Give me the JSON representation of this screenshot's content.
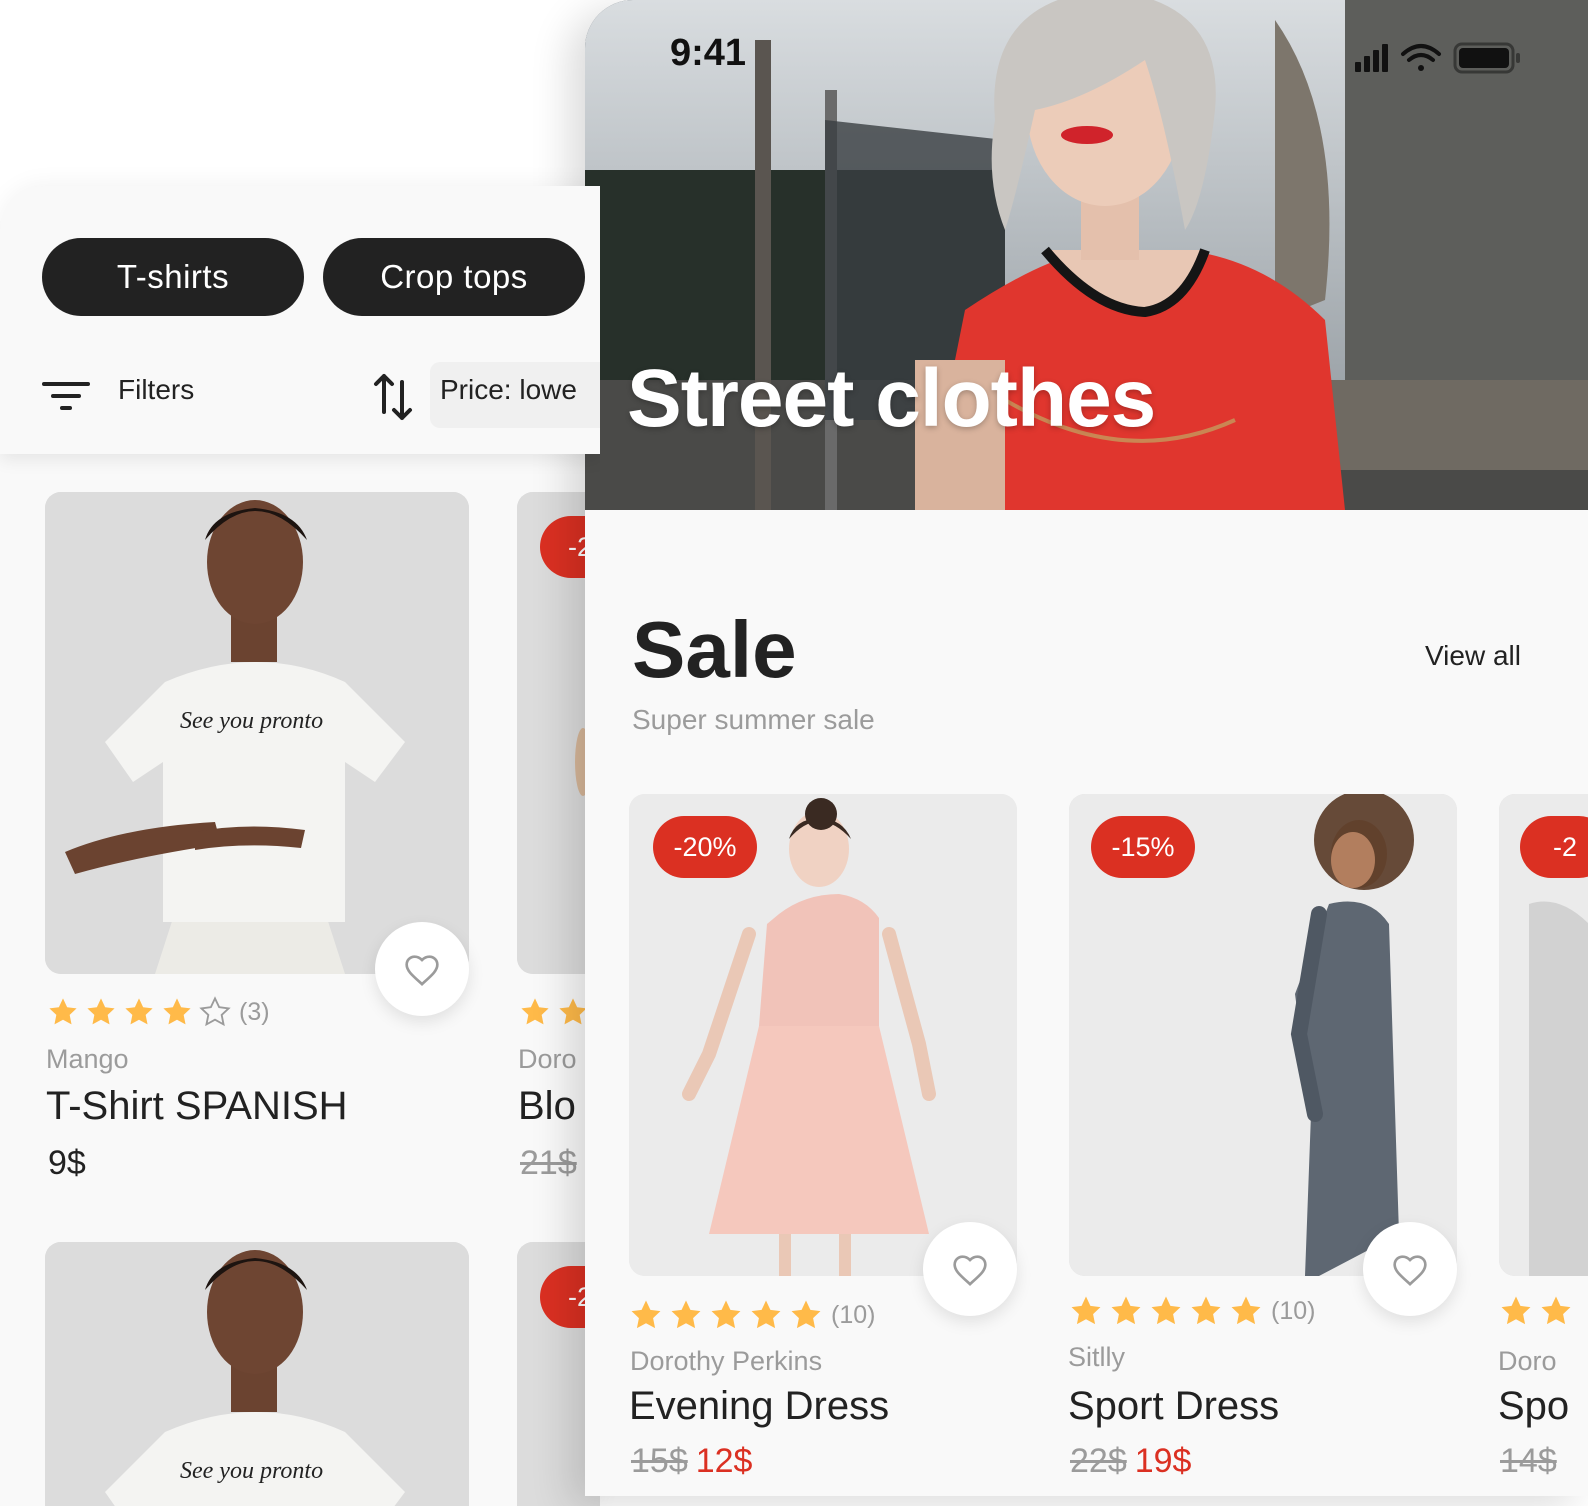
{
  "catalog": {
    "chips": [
      "T-shirts",
      "Crop tops"
    ],
    "filters_label": "Filters",
    "sort_label": "Price: lowe",
    "products": [
      {
        "rating": 4,
        "count": "(3)",
        "brand": "Mango",
        "name": "T-Shirt SPANISH",
        "price": "9$"
      },
      {
        "badge": "-2",
        "brand": "Doro",
        "name": "Blo",
        "old_price": "21$"
      }
    ],
    "row2_badge": "-2"
  },
  "status": {
    "time": "9:41"
  },
  "hero": {
    "title": "Street clothes"
  },
  "sale": {
    "title": "Sale",
    "subtitle": "Super summer sale",
    "view_all": "View all",
    "products": [
      {
        "badge": "-20%",
        "rating": 5,
        "count": "(10)",
        "brand": "Dorothy Perkins",
        "name": "Evening Dress",
        "old_price": "15$",
        "new_price": "12$"
      },
      {
        "badge": "-15%",
        "rating": 5,
        "count": "(10)",
        "brand": "Sitlly",
        "name": "Sport Dress",
        "old_price": "22$",
        "new_price": "19$"
      },
      {
        "badge": "-2",
        "brand": "Doro",
        "name": "Spo",
        "old_price": "14$"
      }
    ]
  },
  "colors": {
    "accent": "#db3022",
    "star": "#ffba49",
    "chip": "#222222",
    "background": "#f9f9f9"
  }
}
